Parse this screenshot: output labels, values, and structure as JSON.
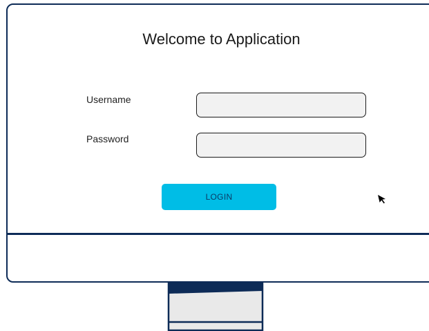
{
  "window": {
    "title": "Welcome to Application"
  },
  "form": {
    "username": {
      "label": "Username",
      "value": "",
      "placeholder": ""
    },
    "password": {
      "label": "Password",
      "value": "",
      "placeholder": ""
    },
    "login_label": "LOGIN"
  },
  "icons": {
    "cursor": "mouse-pointer-icon",
    "stand": "monitor-stand-icon"
  },
  "colors": {
    "frame": "#0d2b57",
    "button": "#00bde6",
    "button_text": "#0b3a66",
    "input_bg": "#f2f2f2"
  }
}
